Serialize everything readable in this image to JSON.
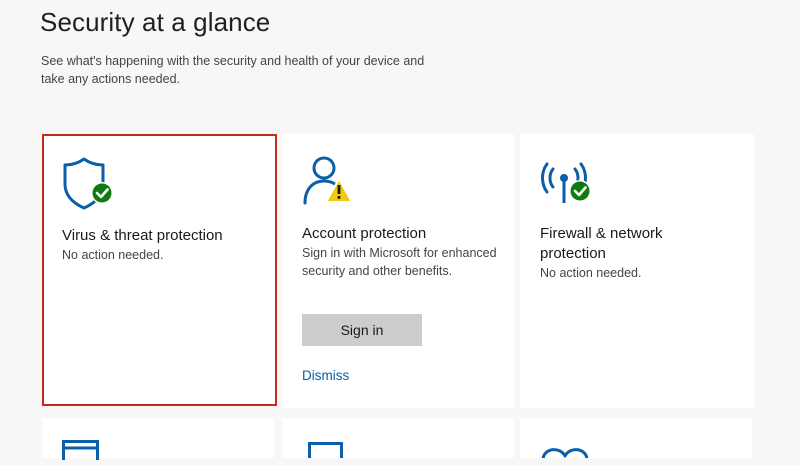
{
  "header": {
    "title": "Security at a glance",
    "subtitle": "See what's happening with the security and health of your device and take any actions needed."
  },
  "tiles": [
    {
      "title": "Virus & threat protection",
      "description": "No action needed.",
      "icon": "shield-check-icon",
      "status": "ok"
    },
    {
      "title": "Account protection",
      "description": "Sign in with Microsoft for enhanced security and other benefits.",
      "icon": "person-warning-icon",
      "status": "warning",
      "action_label": "Sign in",
      "link_label": "Dismiss"
    },
    {
      "title": "Firewall & network protection",
      "description": "No action needed.",
      "icon": "antenna-check-icon",
      "status": "ok"
    }
  ],
  "colors": {
    "accent_blue": "#0a5fa8",
    "ok_green": "#107c10",
    "warning_yellow": "#f2c811",
    "selection_red": "#c42b1c",
    "button_gray": "#cccccc"
  }
}
